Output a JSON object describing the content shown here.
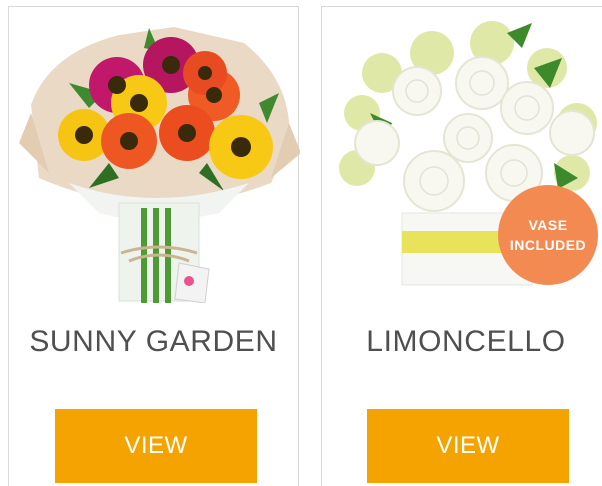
{
  "products": [
    {
      "name": "SUNNY GARDEN",
      "button_label": "VIEW",
      "image_alt": "sunny-garden-bouquet"
    },
    {
      "name": "LIMONCELLO",
      "button_label": "VIEW",
      "image_alt": "limoncello-arrangement",
      "badge": {
        "line1": "VASE",
        "line2": "INCLUDED"
      }
    }
  ],
  "colors": {
    "button": "#f5a300",
    "button_text": "#ffffff",
    "product_name": "#4f4f4f",
    "badge": "#f38a52",
    "card_border": "#d9d9d9"
  }
}
